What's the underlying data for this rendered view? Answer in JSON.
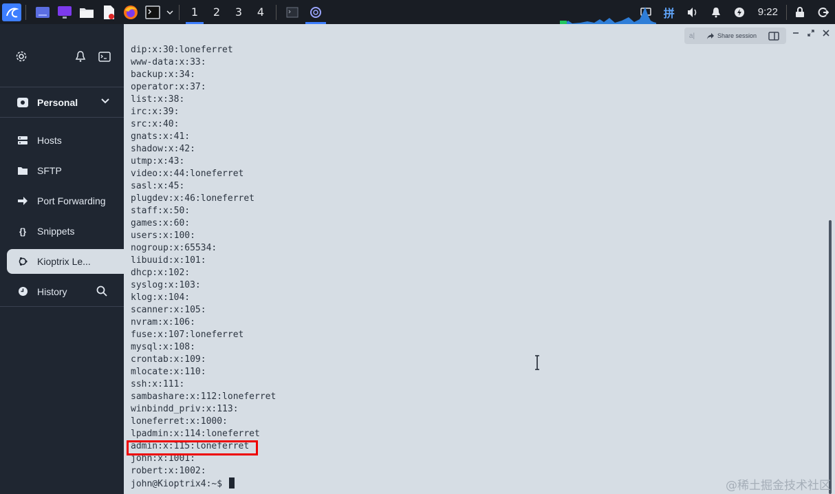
{
  "taskbar": {
    "workspaces": [
      "1",
      "2",
      "3",
      "4"
    ],
    "active_workspace": 0,
    "clock": "9:22",
    "ime_label": "拼"
  },
  "sidebar": {
    "group": "Personal",
    "items": [
      {
        "label": "Hosts",
        "icon": "hosts-icon"
      },
      {
        "label": "SFTP",
        "icon": "folder-icon"
      },
      {
        "label": "Port Forwarding",
        "icon": "port-forward-icon"
      },
      {
        "label": "Snippets",
        "icon": "braces-icon"
      },
      {
        "label": "Kioptrix Le...",
        "icon": "ubuntu-icon",
        "active": true
      },
      {
        "label": "History",
        "icon": "clock-icon"
      }
    ]
  },
  "terminal": {
    "share_label": "Share session",
    "aa_label": "a|",
    "lines": [
      "dip:x:30:loneferret",
      "www-data:x:33:",
      "backup:x:34:",
      "operator:x:37:",
      "list:x:38:",
      "irc:x:39:",
      "src:x:40:",
      "gnats:x:41:",
      "shadow:x:42:",
      "utmp:x:43:",
      "video:x:44:loneferret",
      "sasl:x:45:",
      "plugdev:x:46:loneferret",
      "staff:x:50:",
      "games:x:60:",
      "users:x:100:",
      "nogroup:x:65534:",
      "libuuid:x:101:",
      "dhcp:x:102:",
      "syslog:x:103:",
      "klog:x:104:",
      "scanner:x:105:",
      "nvram:x:106:",
      "fuse:x:107:loneferret",
      "mysql:x:108:",
      "crontab:x:109:",
      "mlocate:x:110:",
      "ssh:x:111:",
      "sambashare:x:112:loneferret",
      "winbindd_priv:x:113:",
      "loneferret:x:1000:",
      "lpadmin:x:114:loneferret",
      "admin:x:115:loneferret",
      "john:x:1001:",
      "robert:x:1002:"
    ],
    "prompt": "john@Kioptrix4:~$ ",
    "highlighted_line": "admin:x:115:loneferret"
  },
  "watermark": "@稀土掘金技术社区",
  "colors": {
    "sidebar_bg": "#1f2631",
    "terminal_bg": "#d6dde4",
    "highlight_box": "#ee0000",
    "accent": "#3d7eff"
  }
}
